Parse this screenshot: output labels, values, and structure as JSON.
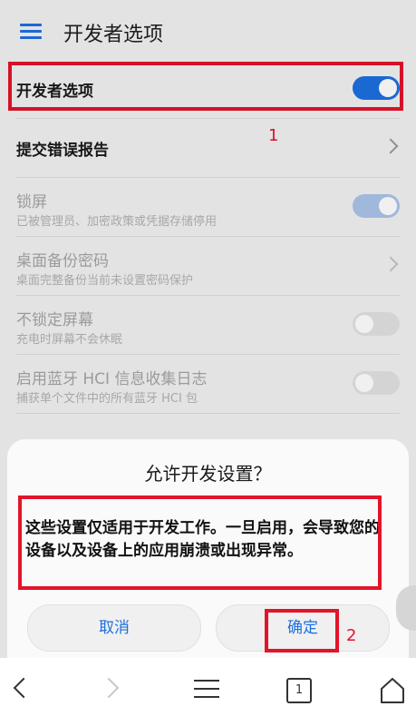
{
  "appbar": {
    "title": "开发者选项",
    "menu_icon": "hamburger-menu-icon"
  },
  "settings": [
    {
      "title": "开发者选项",
      "subtitle": "",
      "control": "toggle",
      "state": "on"
    },
    {
      "title": "提交错误报告",
      "subtitle": "",
      "control": "chevron"
    },
    {
      "title": "锁屏",
      "subtitle": "已被管理员、加密政策或凭据存储停用",
      "control": "toggle",
      "state": "on-disabled"
    },
    {
      "title": "桌面备份密码",
      "subtitle": "桌面完整备份当前未设置密码保护",
      "control": "chevron"
    },
    {
      "title": "不锁定屏幕",
      "subtitle": "充电时屏幕不会休眠",
      "control": "toggle",
      "state": "off"
    },
    {
      "title": "启用蓝牙 HCI 信息收集日志",
      "subtitle": "捕获单个文件中的所有蓝牙 HCI 包",
      "control": "toggle",
      "state": "off"
    }
  ],
  "annotations": {
    "marker1": "1",
    "marker2": "2"
  },
  "dialog": {
    "title": "允许开发设置？",
    "message": "这些设置仅适用于开发工作。一旦启用，会导致您的设备以及设备上的应用崩溃或出现异常。",
    "cancel_label": "取消",
    "confirm_label": "确定"
  },
  "navbar": {
    "tab_count": "1"
  },
  "colors": {
    "accent": "#1c6fe0",
    "highlight": "#e2142a",
    "background": "#f2f2f2"
  }
}
